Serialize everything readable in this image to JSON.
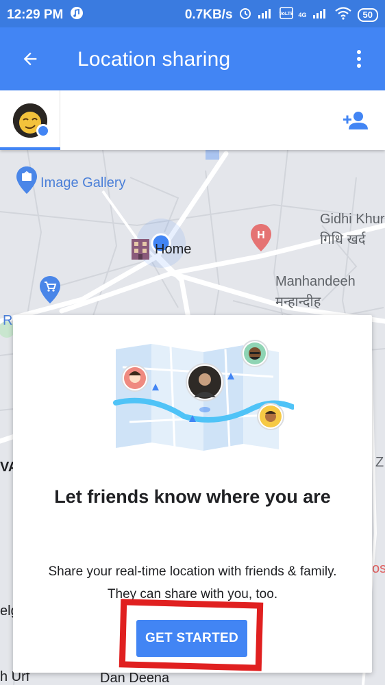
{
  "status_bar": {
    "time": "12:29 PM",
    "network_speed": "0.7KB/s",
    "network_type": "4G",
    "battery": "50"
  },
  "app_bar": {
    "title": "Location sharing"
  },
  "map": {
    "labels": {
      "image_gallery": "Image Gallery",
      "home": "Home",
      "gidhi_khurd_en": "Gidhi Khur",
      "gidhi_khurd_hi": "गिधि खर्द",
      "manhandeeh_en": "Manhandeeh",
      "manhandeeh_hi": "मन्हान्दीह",
      "left_r": "R",
      "left_va": "VA",
      "left_elg": "elg",
      "left_urf": "h Urf",
      "bottom_deena": "Dan Deena",
      "right_z": "Z",
      "right_os": "os"
    }
  },
  "card": {
    "title": "Let friends know where you are",
    "description": "Share your real-time location with friends & family. They can share with you, too.",
    "button_label": "GET STARTED"
  },
  "colors": {
    "app_bar": "#4285f4",
    "status_bar": "#3a7be0",
    "accent": "#4285f4",
    "highlight": "#e02020"
  }
}
